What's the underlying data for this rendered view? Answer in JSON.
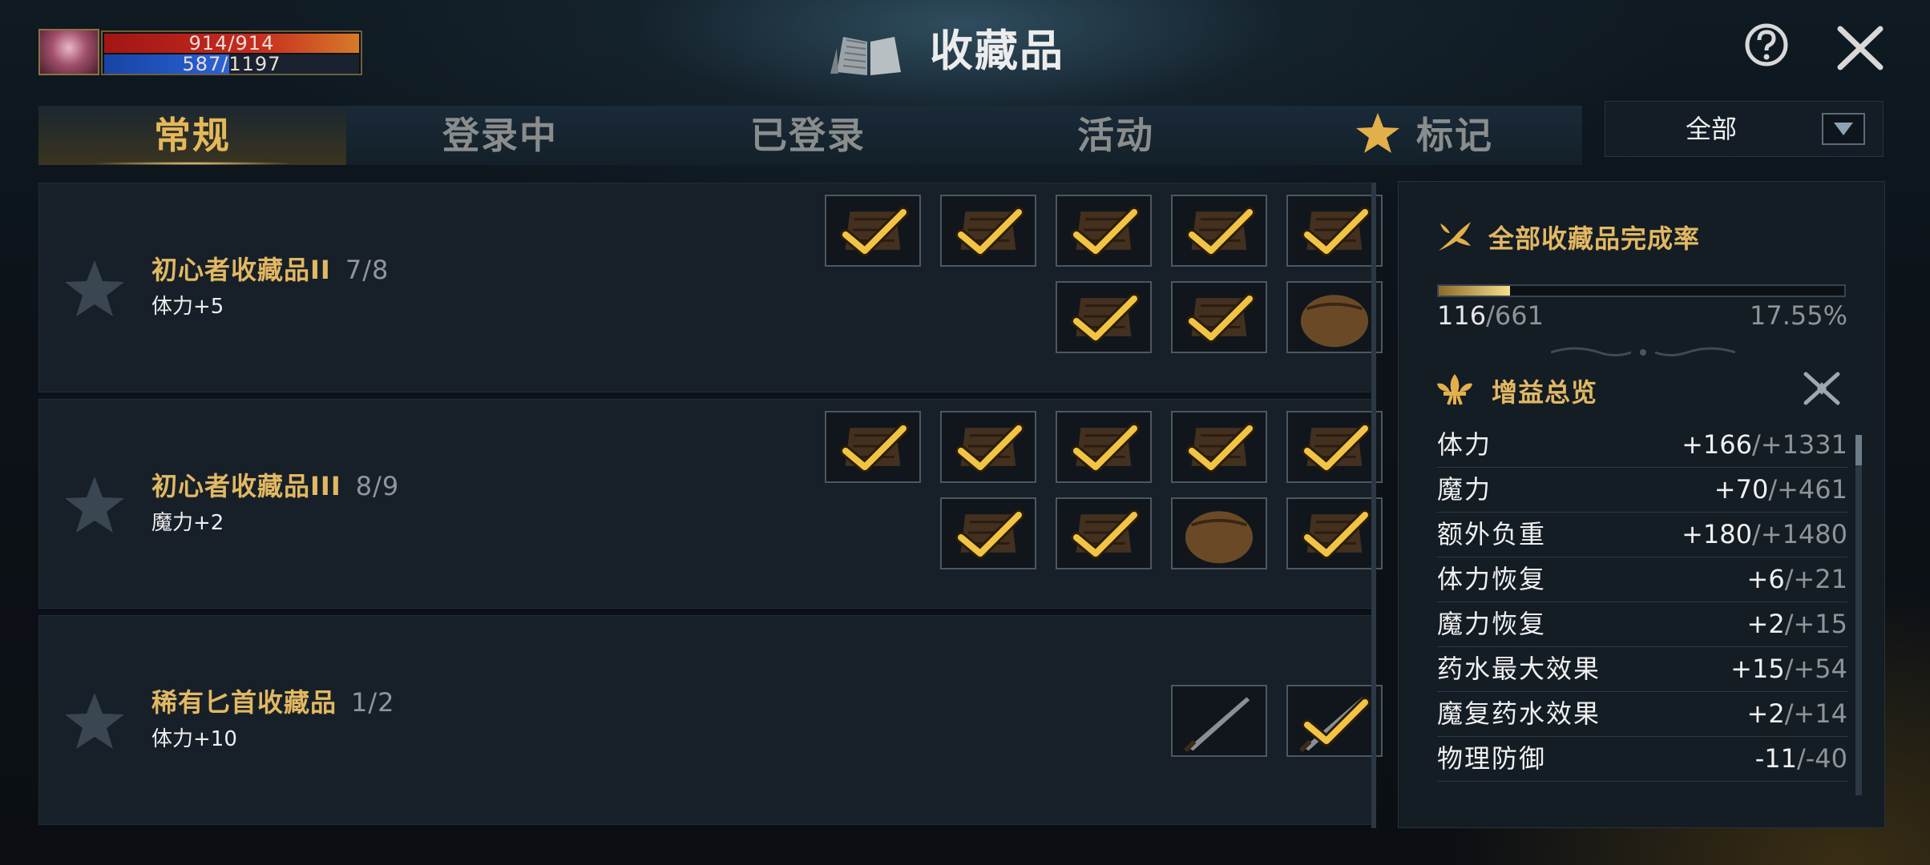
{
  "player": {
    "hp_text": "914/914",
    "hp_fraction": 1.0,
    "mp_text": "587/1197",
    "mp_fraction": 0.49
  },
  "header": {
    "title": "收藏品"
  },
  "tabs": [
    {
      "label": "常规",
      "active": true
    },
    {
      "label": "登录中",
      "active": false
    },
    {
      "label": "已登录",
      "active": false
    },
    {
      "label": "活动",
      "active": false
    },
    {
      "label": "标记",
      "active": false,
      "icon": "star-icon"
    }
  ],
  "filter": {
    "selected": "全部"
  },
  "collections": [
    {
      "name": "初心者收藏品II",
      "count": "7/8",
      "bonus": "体力+5",
      "items": [
        {
          "icon": "armor-icon",
          "collected": true
        },
        {
          "icon": "greaves-icon",
          "collected": true
        },
        {
          "icon": "leather-armor-icon",
          "collected": true
        },
        {
          "icon": "helmet-icon",
          "collected": true
        },
        {
          "icon": "bow-icon",
          "collected": true
        },
        {
          "icon": "gauntlet-icon",
          "collected": true
        },
        {
          "icon": "boots-icon",
          "collected": true
        },
        {
          "icon": "pouch-icon",
          "collected": false
        }
      ]
    },
    {
      "name": "初心者收藏品III",
      "count": "8/9",
      "bonus": "魔力+2",
      "items": [
        {
          "icon": "greaves-icon",
          "collected": true
        },
        {
          "icon": "leather-armor-icon",
          "collected": true
        },
        {
          "icon": "gloves-icon",
          "collected": true
        },
        {
          "icon": "helmet-icon",
          "collected": true
        },
        {
          "icon": "bow-icon",
          "collected": true
        },
        {
          "icon": "tunic-icon",
          "collected": true
        },
        {
          "icon": "boots-icon",
          "collected": true
        },
        {
          "icon": "pouch-icon",
          "collected": false
        },
        {
          "icon": "armor-icon",
          "collected": true
        }
      ]
    },
    {
      "name": "稀有匕首收藏品",
      "count": "1/2",
      "bonus": "体力+10",
      "items": [
        {
          "icon": "dagger-icon",
          "collected": false
        },
        {
          "icon": "dagger-icon",
          "collected": true
        }
      ]
    }
  ],
  "completion": {
    "title": "全部收藏品完成率",
    "collected": "116",
    "total": "/661",
    "percent": "17.55%",
    "fraction": 0.1755
  },
  "buffs": {
    "title": "增益总览",
    "stats": [
      {
        "name": "体力",
        "value": "+166",
        "max": "/+1331"
      },
      {
        "name": "魔力",
        "value": "+70",
        "max": "/+461"
      },
      {
        "name": "额外负重",
        "value": "+180",
        "max": "/+1480"
      },
      {
        "name": "体力恢复",
        "value": "+6",
        "max": "/+21"
      },
      {
        "name": "魔力恢复",
        "value": "+2",
        "max": "/+15"
      },
      {
        "name": "药水最大效果",
        "value": "+15",
        "max": "/+54"
      },
      {
        "name": "魔复药水效果",
        "value": "+2",
        "max": "/+14"
      },
      {
        "name": "物理防御",
        "value": "-11",
        "max": "/-40"
      }
    ]
  },
  "colors": {
    "gold": "#e2b862",
    "hp": "#c72c1e",
    "mp": "#2a62d6",
    "panel": "#172028"
  }
}
